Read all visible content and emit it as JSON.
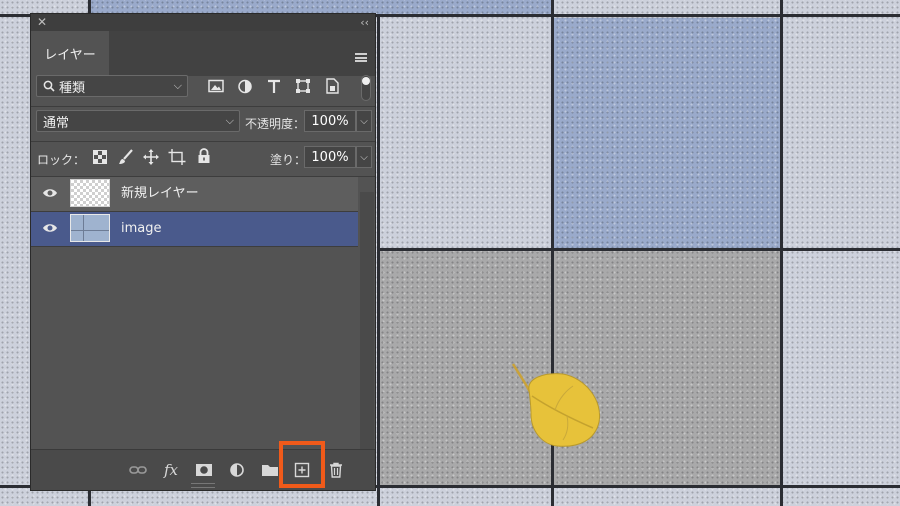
{
  "panel": {
    "close_glyph": "✕",
    "collapse_glyph": "‹‹",
    "tab_label": "レイヤー",
    "filter": {
      "label": "種類",
      "icons": [
        "image-filter-icon",
        "adjustment-filter-icon",
        "type-filter-icon",
        "shape-filter-icon",
        "smart-object-filter-icon"
      ]
    },
    "blend_mode": "通常",
    "opacity_label": "不透明度：",
    "opacity_value": "100%",
    "lock_label": "ロック：",
    "fill_label": "塗り：",
    "fill_value": "100%",
    "layers": [
      {
        "name": "新規レイヤー",
        "visible": true,
        "selected": false,
        "thumbnail": "transparent"
      },
      {
        "name": "image",
        "visible": true,
        "selected": true,
        "thumbnail": "photo"
      }
    ],
    "footer_icons": [
      "link-layers-icon",
      "fx-icon",
      "add-mask-icon",
      "adjustment-layer-icon",
      "new-group-icon",
      "new-layer-icon",
      "delete-layer-icon"
    ],
    "fx_text": "fx"
  },
  "colors": {
    "panel_bg": "#535353",
    "selected_layer": "#4a5a8c",
    "highlight": "#f05a1a",
    "leaf": "#e7c23a"
  }
}
